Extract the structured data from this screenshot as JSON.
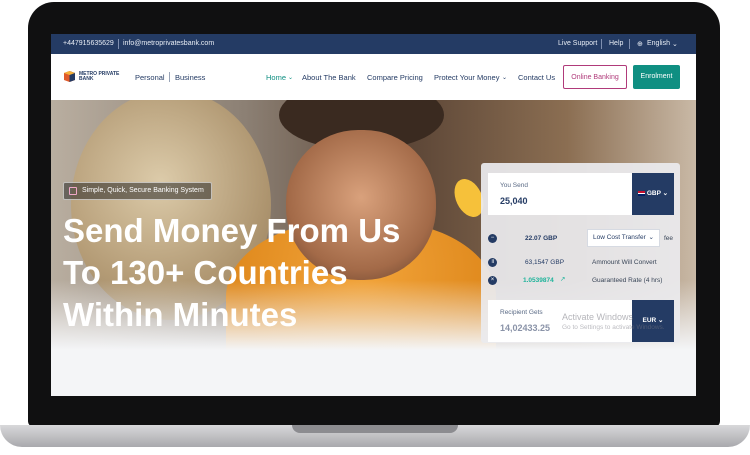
{
  "topbar": {
    "phone": "+447915635629",
    "email": "info@metroprivatesbank.com",
    "live_support": "Live Support",
    "help": "Help",
    "language": "English"
  },
  "logo": {
    "name": "METRO PRIVATE BANK"
  },
  "nav": {
    "personal": "Personal",
    "business": "Business",
    "items": [
      "Home",
      "About The Bank",
      "Compare Pricing",
      "Protect Your Money",
      "Contact Us"
    ],
    "online_banking": "Online Banking",
    "enrolment": "Enrolment"
  },
  "hero": {
    "badge": "Simple, Quick, Secure Banking System",
    "title_lines": [
      "Send Money From Us",
      "To 130+ Countries",
      "Within Minutes"
    ]
  },
  "calculator": {
    "you_send_label": "You Send",
    "you_send_value": "25,040",
    "send_currency": "GBP",
    "fee_amount": "22.07 GBP",
    "transfer_type": "Low Cost Transfer",
    "fee_label": "fee",
    "convert_amount": "63,1547 GBP",
    "convert_label": "Ammount Will Convert",
    "rate": "1.0539874",
    "rate_label": "Guaranteed Rate (4 hrs)",
    "recipient_label": "Recipient Gets",
    "recipient_value": "14,02433.25",
    "recipient_currency": "EUR"
  },
  "watermark": {
    "line1": "Activate Windows",
    "line2": "Go to Settings to activate Windows."
  },
  "colors": {
    "topbar": "#243b64",
    "accent_teal": "#0f8f82",
    "accent_magenta": "#b03a7a",
    "rate_green": "#1db39a"
  }
}
